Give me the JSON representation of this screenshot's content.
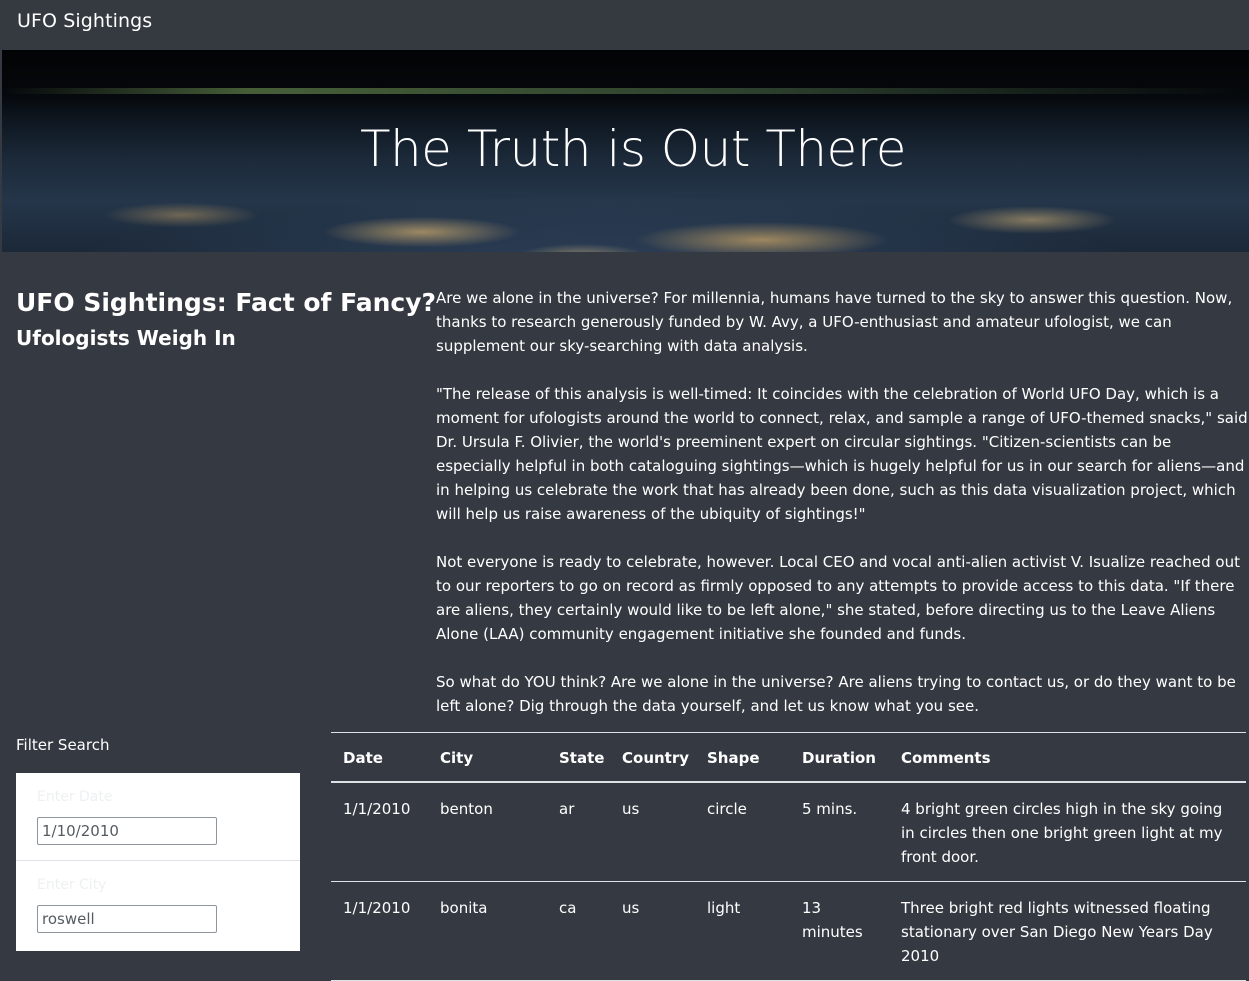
{
  "navbar": {
    "brand": "UFO Sightings"
  },
  "hero": {
    "title": "The Truth is Out There"
  },
  "intro": {
    "title": "UFO Sightings: Fact of Fancy?",
    "subtitle": "Ufologists Weigh In"
  },
  "article": {
    "paragraphs": [
      "Are we alone in the universe? For millennia, humans have turned to the sky to answer this question. Now, thanks to research generously funded by W. Avy, a UFO-enthusiast and amateur ufologist, we can supplement our sky-searching with data analysis.",
      "\"The release of this analysis is well-timed: It coincides with the celebration of World UFO Day, which is a moment for ufologists around the world to connect, relax, and sample a range of UFO-themed snacks,\" said Dr. Ursula F. Olivier, the world's preeminent expert on circular sightings. \"Citizen-scientists can be especially helpful in both cataloguing sightings—which is hugely helpful for us in our search for aliens—and in helping us celebrate the work that has already been done, such as this data visualization project, which will help us raise awareness of the ubiquity of sightings!\"",
      "Not everyone is ready to celebrate, however. Local CEO and vocal anti-alien activist V. Isualize reached out to our reporters to go on record as firmly opposed to any attempts to provide access to this data. \"If there are aliens, they certainly would like to be left alone,\" she stated, before directing us to the Leave Aliens Alone (LAA) community engagement initiative she founded and funds.",
      "So what do YOU think? Are we alone in the universe? Are aliens trying to contact us, or do they want to be left alone? Dig through the data yourself, and let us know what you see."
    ]
  },
  "filters": {
    "heading": "Filter Search",
    "date": {
      "label": "Enter Date",
      "value": "1/10/2010"
    },
    "city": {
      "label": "Enter City",
      "value": "roswell"
    }
  },
  "table": {
    "columns": [
      "Date",
      "City",
      "State",
      "Country",
      "Shape",
      "Duration",
      "Comments"
    ],
    "rows": [
      [
        "1/1/2010",
        "benton",
        "ar",
        "us",
        "circle",
        "5 mins.",
        "4 bright green circles high in the sky going in circles then one bright green light at my front door."
      ],
      [
        "1/1/2010",
        "bonita",
        "ca",
        "us",
        "light",
        "13 minutes",
        "Three bright red lights witnessed floating stationary over San Diego New Years Day 2010"
      ]
    ]
  }
}
